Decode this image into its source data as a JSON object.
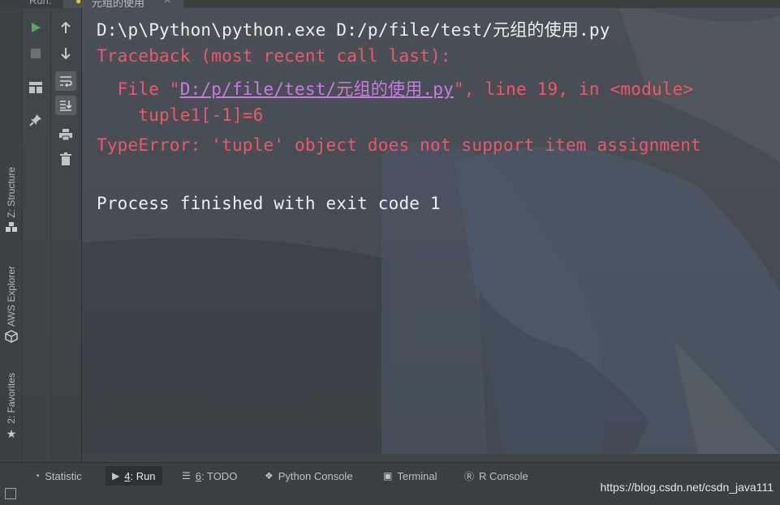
{
  "top": {
    "run_label": "Run:",
    "tab_name": "元组的使用"
  },
  "left_stripe": {
    "structure": "Z: Structure",
    "aws": "AWS Explorer",
    "favorites": "2: Favorites"
  },
  "console": {
    "command": "D:\\p\\Python\\python.exe D:/p/file/test/元组的使用.py",
    "traceback": "Traceback (most recent call last):",
    "file_prefix": "  File \"",
    "file_link": "D:/p/file/test/元组的使用.py",
    "file_suffix": "\", line 19, in <module>",
    "code_line": "    tuple1[-1]=6",
    "error": "TypeError: 'tuple' object does not support item assignment",
    "process": "Process finished with exit code 1"
  },
  "bottom_tabs": [
    {
      "label": "Statistic"
    },
    {
      "mnemonic": "4",
      "label": ": Run"
    },
    {
      "mnemonic": "6",
      "label": ": TODO"
    },
    {
      "label": "Python Console"
    },
    {
      "label": "Terminal"
    },
    {
      "label": "R Console"
    }
  ],
  "watermark": "https://blog.csdn.net/csdn_java111",
  "colors": {
    "error_red": "#f0556a",
    "link_purple": "#c87be0",
    "run_green": "#4caf50"
  }
}
